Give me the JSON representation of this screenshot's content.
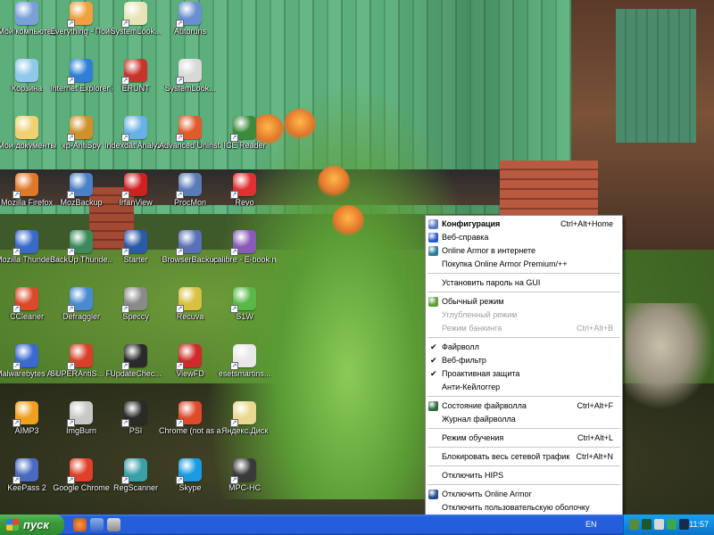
{
  "desktop": {
    "icons": [
      {
        "label": "Мой компьютер",
        "color": "#7aa0d8"
      },
      {
        "label": "Everything - Поиск",
        "color": "#f0a040"
      },
      {
        "label": "SystemLook...",
        "color": "#e8e4b8"
      },
      {
        "label": "Autoruns",
        "color": "#6a8fd0"
      },
      {
        "label": "Корзина",
        "color": "#8fc8e8"
      },
      {
        "label": "Internet Explorer (no...",
        "color": "#2f7fd8"
      },
      {
        "label": "ERUNT",
        "color": "#c8342a"
      },
      {
        "label": "SystemLook...",
        "color": "#d8d8d8"
      },
      {
        "label": "Мои документы",
        "color": "#f0d070"
      },
      {
        "label": "xp-AntiSpy",
        "color": "#d0902a"
      },
      {
        "label": "Indexdat Analyzer",
        "color": "#6ab0e8"
      },
      {
        "label": "Advanced Uninstaller PR...",
        "color": "#e05a2a"
      },
      {
        "label": "ICE Reader",
        "color": "#3c8a3c"
      },
      {
        "label": "Mozilla Firefox",
        "color": "#e0782a"
      },
      {
        "label": "MozBackup",
        "color": "#4a80c8"
      },
      {
        "label": "IrfanView",
        "color": "#d02020"
      },
      {
        "label": "ProcMon",
        "color": "#5a7ab8"
      },
      {
        "label": "Revo",
        "color": "#e03030"
      },
      {
        "label": "Mozilla Thunderbird",
        "color": "#3a6ac8"
      },
      {
        "label": "BackUp Thunde...",
        "color": "#3a8a5a"
      },
      {
        "label": "Starter",
        "color": "#2a5aa8"
      },
      {
        "label": "BrowserBackup",
        "color": "#5a70b8"
      },
      {
        "label": "calibre - E-book management",
        "color": "#8a5ab8"
      },
      {
        "label": "CCleaner",
        "color": "#d84a2a"
      },
      {
        "label": "Defraggler",
        "color": "#4a8ad0"
      },
      {
        "label": "Speccy",
        "color": "#8a8a8a"
      },
      {
        "label": "Recuva",
        "color": "#d8c040"
      },
      {
        "label": "S1W",
        "color": "#58b848"
      },
      {
        "label": "Malwarebytes Anti-Malware",
        "color": "#3a6ad0"
      },
      {
        "label": "SUPERAntiS... Free Edition",
        "color": "#d8402a"
      },
      {
        "label": "UpdateChec...",
        "color": "#2a2a2a"
      },
      {
        "label": "ViewFD",
        "color": "#d02a2a"
      },
      {
        "label": "esetsmartins...",
        "color": "#e8e8e8"
      },
      {
        "label": "AIMP3",
        "color": "#f0a020"
      },
      {
        "label": "ImgBurn",
        "color": "#c8c8c8"
      },
      {
        "label": "PSI",
        "color": "#2a2a2a"
      },
      {
        "label": "Chrome (not as admin)",
        "color": "#e04a2a"
      },
      {
        "label": "Яндекс.Диск",
        "color": "#e8d890"
      },
      {
        "label": "KeePass 2",
        "color": "#4a6ac0"
      },
      {
        "label": "Google Chrome",
        "color": "#e0402a"
      },
      {
        "label": "RegScanner",
        "color": "#3aa0a8"
      },
      {
        "label": "Skype",
        "color": "#1a9ae0"
      },
      {
        "label": "MPC-HC",
        "color": "#3a3a3a"
      }
    ]
  },
  "menu": {
    "items": [
      {
        "label": "Конфигурация",
        "shortcut": "Ctrl+Alt+Home",
        "bold": true,
        "icon": "config-icon",
        "icon_color": "#5a7ac8"
      },
      {
        "label": "Веб-справка",
        "icon": "help-icon",
        "icon_color": "#2a5ad0"
      },
      {
        "label": "Online Armor в интернете",
        "icon": "globe-icon",
        "icon_color": "#2a7a9a"
      },
      {
        "label": "Покупка Online Armor Premium/++"
      },
      {
        "separator": true
      },
      {
        "label": "Установить пароль на GUI"
      },
      {
        "separator": true
      },
      {
        "label": "Обычный режим",
        "icon": "user-icon",
        "icon_color": "#5aa038"
      },
      {
        "label": "Углубленный режим",
        "disabled": true
      },
      {
        "label": "Режим банкинга",
        "shortcut": "Ctrl+Alt+B",
        "disabled": true
      },
      {
        "separator": true
      },
      {
        "label": "Файрволл",
        "checked": true
      },
      {
        "label": "Веб-фильтр",
        "checked": true
      },
      {
        "label": "Проактивная защита",
        "checked": true
      },
      {
        "label": "Анти-Кейлоггер"
      },
      {
        "separator": true
      },
      {
        "label": "Состояние файрволла",
        "shortcut": "Ctrl+Alt+F",
        "icon": "firewall-status-icon",
        "icon_color": "#2a6a3a"
      },
      {
        "label": "Журнал файрволла"
      },
      {
        "separator": true
      },
      {
        "label": "Режим обучения",
        "shortcut": "Ctrl+Alt+L"
      },
      {
        "separator": true
      },
      {
        "label": "Блокировать весь сетевой трафик",
        "shortcut": "Ctrl+Alt+N"
      },
      {
        "separator": true
      },
      {
        "label": "Отключить HIPS"
      },
      {
        "separator": true
      },
      {
        "label": "Отключить Online Armor",
        "icon": "shield-icon",
        "icon_color": "#2a4a8a"
      },
      {
        "label": "Отключить пользовательскую оболочку"
      }
    ]
  },
  "taskbar": {
    "start_label": "пуск",
    "language": "EN",
    "clock": "11:57"
  }
}
